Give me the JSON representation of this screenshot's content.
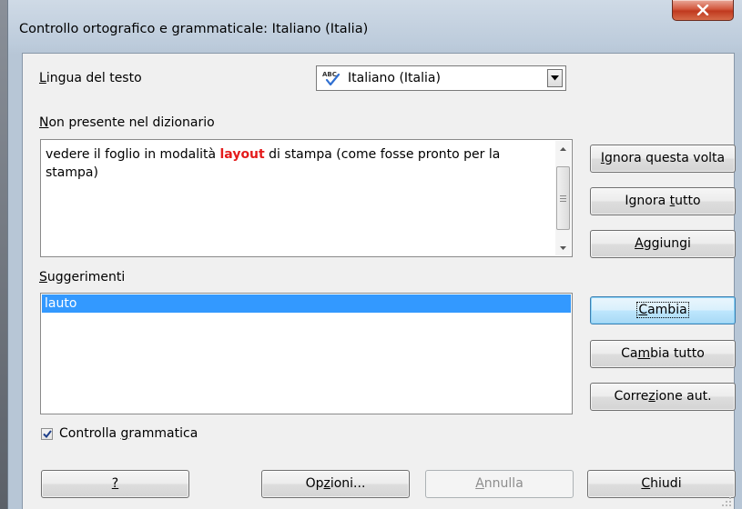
{
  "window": {
    "title": "Controllo ortografico e grammaticale: Italiano (Italia)",
    "close_glyph": "x"
  },
  "language": {
    "label": "Lingua del testo",
    "value": "Italiano (Italia)",
    "icon": "spellcheck-abc-icon"
  },
  "not_in_dictionary": {
    "label": "Non presente nel dizionario",
    "text_before": "vedere il foglio in modalità ",
    "misspelled_word": "layout",
    "text_after": " di stampa (come fosse pronto per la stampa)"
  },
  "suggestions": {
    "label": "Suggerimenti",
    "items": [
      "lauto"
    ],
    "selected_index": 0
  },
  "side_buttons": {
    "ignore_once": "Ignora questa volta",
    "ignore_all": "Ignora tutto",
    "add": "Aggiungi",
    "change": "Cambia",
    "change_all": "Cambia tutto",
    "autocorrect": "Correzione aut."
  },
  "check_grammar": {
    "label": "Controlla grammatica",
    "checked": true
  },
  "bottom_buttons": {
    "help": "?",
    "options": "Opzioni...",
    "undo": "Annulla",
    "close": "Chiudi"
  },
  "colors": {
    "misspelled": "#e41b1b",
    "selection": "#3399ff",
    "close_button": "#c0391f"
  }
}
